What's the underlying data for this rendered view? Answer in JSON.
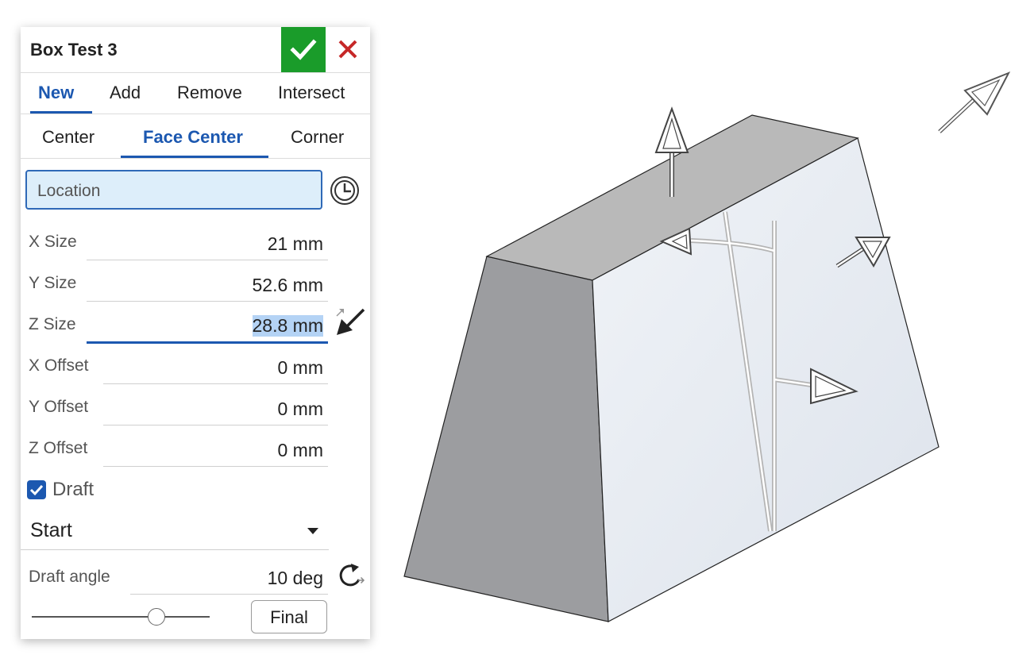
{
  "dialog": {
    "title": "Box Test 3",
    "accept_icon": "checkmark-icon",
    "cancel_icon": "close-icon",
    "operation_tabs": [
      {
        "label": "New",
        "active": true
      },
      {
        "label": "Add",
        "active": false
      },
      {
        "label": "Remove",
        "active": false
      },
      {
        "label": "Intersect",
        "active": false
      }
    ],
    "mode_tabs": [
      {
        "label": "Center",
        "active": false
      },
      {
        "label": "Face Center",
        "active": true
      },
      {
        "label": "Corner",
        "active": false
      }
    ],
    "location_placeholder": "Location",
    "location_icon": "clock-icon",
    "fields": [
      {
        "label": "X Size",
        "value": "21 mm"
      },
      {
        "label": "Y Size",
        "value": "52.6 mm"
      },
      {
        "label": "Z Size",
        "value": "28.8 mm",
        "selected": true
      },
      {
        "label": "X Offset",
        "value": "0 mm"
      },
      {
        "label": "Y Offset",
        "value": "0 mm"
      },
      {
        "label": "Z Offset",
        "value": "0 mm"
      }
    ],
    "direction_icon": "opposite-direction-arrow-icon",
    "draft": {
      "label": "Draft",
      "checked": true
    },
    "draft_type": {
      "selected": "Start"
    },
    "draft_angle": {
      "label": "Draft angle",
      "value": "10 deg",
      "reset_icon": "rotate-icon"
    },
    "slider_level": 0.7,
    "final_button": "Final"
  },
  "colors": {
    "accent": "#1c58b0",
    "accept": "#1a9c2a",
    "cancel": "#c62828",
    "highlight": "#b4d3f5",
    "field_bg": "#ddeefa"
  }
}
